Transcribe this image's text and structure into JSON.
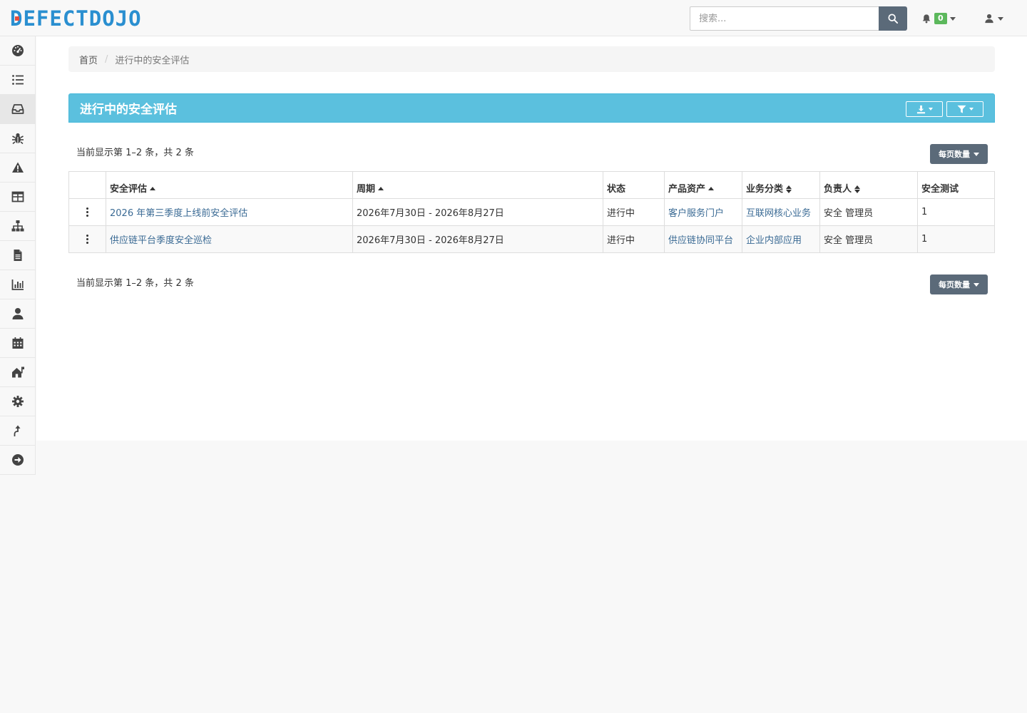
{
  "brand": {
    "logo_text": "DEFECTDOJO",
    "accent": "#2a8fd0",
    "logo_dot": "#e74c3c"
  },
  "header": {
    "search_placeholder": "搜索...",
    "notification_count": "0"
  },
  "sidebar": {
    "items": [
      {
        "icon": "dashboard-icon"
      },
      {
        "icon": "list-icon"
      },
      {
        "icon": "inbox-icon",
        "active": true
      },
      {
        "icon": "bug-icon"
      },
      {
        "icon": "warning-icon"
      },
      {
        "icon": "table-icon"
      },
      {
        "icon": "sitemap-icon"
      },
      {
        "icon": "file-icon"
      },
      {
        "icon": "bar-chart-icon"
      },
      {
        "icon": "user-icon"
      },
      {
        "icon": "calendar-icon"
      },
      {
        "icon": "home-flag-icon"
      },
      {
        "icon": "gear-icon"
      },
      {
        "icon": "upload-arrow-icon"
      },
      {
        "icon": "arrow-circle-right-icon"
      }
    ]
  },
  "breadcrumb": {
    "home": "首页",
    "current": "进行中的安全评估"
  },
  "panel": {
    "title": "进行中的安全评估",
    "color": "#5bc0de"
  },
  "pagination": {
    "summary": "当前显示第 1–2 条，共 2 条",
    "per_page_label": "每页数量"
  },
  "table": {
    "columns": [
      "安全评估",
      "周期",
      "状态",
      "产品资产",
      "业务分类",
      "负责人",
      "安全测试"
    ],
    "rows": [
      {
        "name": "2026 年第三季度上线前安全评估",
        "period": "2026年7月30日 - 2026年8月27日",
        "status": "进行中",
        "product": "客户服务门户",
        "category": "互联网核心业务",
        "lead": "安全 管理员",
        "tests": "1"
      },
      {
        "name": "供应链平台季度安全巡检",
        "period": "2026年7月30日 - 2026年8月27日",
        "status": "进行中",
        "product": "供应链协同平台",
        "category": "企业内部应用",
        "lead": "安全 管理员",
        "tests": "1"
      }
    ]
  }
}
